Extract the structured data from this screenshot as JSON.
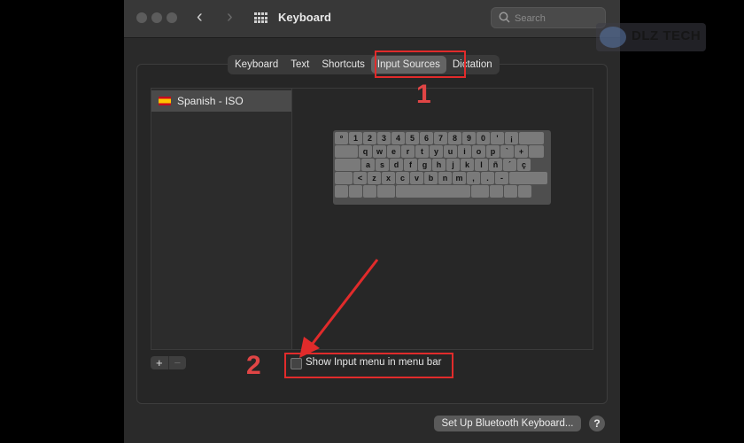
{
  "window": {
    "title": "Keyboard"
  },
  "search": {
    "placeholder": "Search"
  },
  "watermark": {
    "text": "DLZ TECH"
  },
  "tabs": [
    {
      "label": "Keyboard",
      "active": false
    },
    {
      "label": "Text",
      "active": false
    },
    {
      "label": "Shortcuts",
      "active": false
    },
    {
      "label": "Input Sources",
      "active": true
    },
    {
      "label": "Dictation",
      "active": false
    }
  ],
  "input_sources": [
    {
      "label": "Spanish - ISO",
      "flag": "spain-flag-icon",
      "selected": true
    }
  ],
  "keyboard_layout": {
    "rows": [
      [
        "º",
        "1",
        "2",
        "3",
        "4",
        "5",
        "6",
        "7",
        "8",
        "9",
        "0",
        "'",
        "¡",
        ""
      ],
      [
        "",
        "q",
        "w",
        "e",
        "r",
        "t",
        "y",
        "u",
        "i",
        "o",
        "p",
        "`",
        "+",
        ""
      ],
      [
        "",
        "a",
        "s",
        "d",
        "f",
        "g",
        "h",
        "j",
        "k",
        "l",
        "ñ",
        "´",
        "ç"
      ],
      [
        "",
        "<",
        "z",
        "x",
        "c",
        "v",
        "b",
        "n",
        "m",
        ",",
        ".",
        "-",
        ""
      ],
      [
        "",
        "",
        "",
        "",
        "",
        "",
        "",
        "",
        ""
      ]
    ]
  },
  "list_controls": {
    "add_label": "+",
    "remove_label": "−"
  },
  "show_input_menu": {
    "label": "Show Input menu in menu bar",
    "checked": false
  },
  "buttons": {
    "bluetooth_label": "Set Up Bluetooth Keyboard...",
    "help_label": "?"
  },
  "annotations": {
    "step1": "1",
    "step2": "2",
    "accent_color": "#e12b2b"
  },
  "colors": {
    "window_bg": "#2a2a2a",
    "titlebar_bg": "#383838",
    "active_tab": "#646464"
  }
}
